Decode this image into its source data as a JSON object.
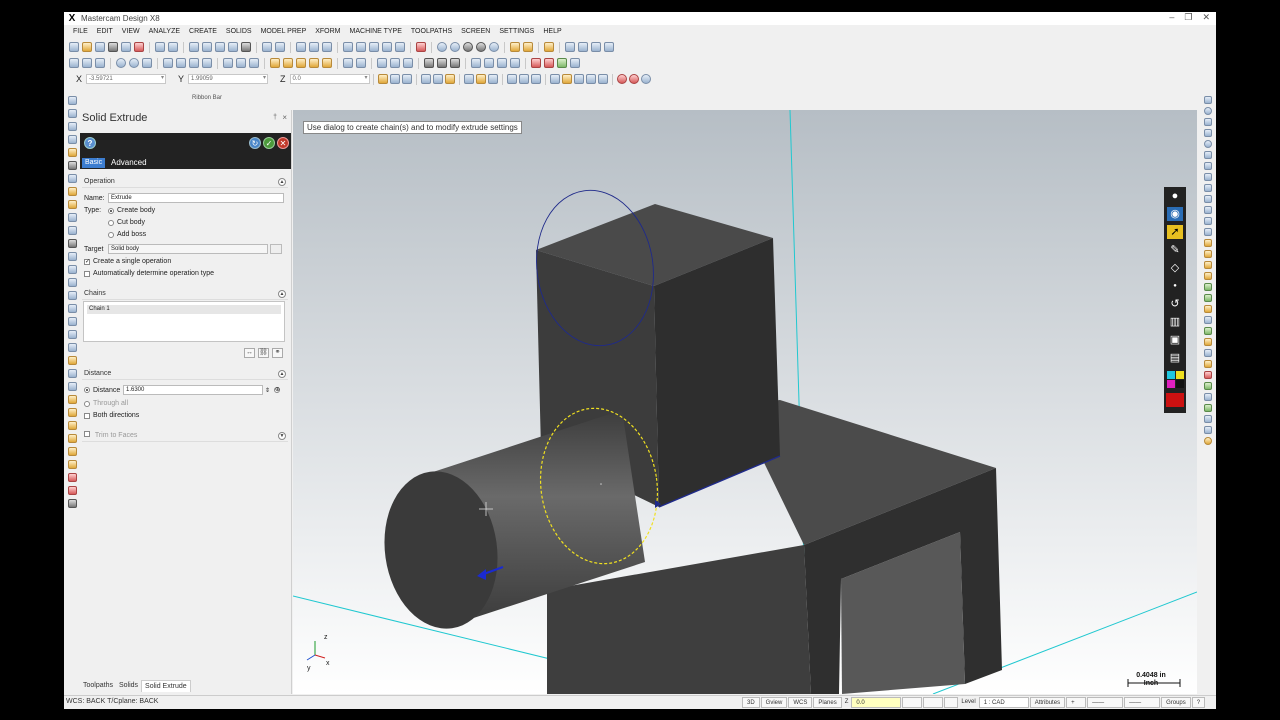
{
  "window": {
    "title": "Mastercam Design X8",
    "icon_glyph": "X"
  },
  "menu": [
    "FILE",
    "EDIT",
    "VIEW",
    "ANALYZE",
    "CREATE",
    "SOLIDS",
    "MODEL PREP",
    "XFORM",
    "MACHINE TYPE",
    "TOOLPATHS",
    "SCREEN",
    "SETTINGS",
    "HELP"
  ],
  "coords": {
    "x_label": "X",
    "x_value": "-3.59721",
    "y_label": "Y",
    "y_value": "1.99059",
    "z_label": "Z",
    "z_value": "0.0"
  },
  "ribbon_bar_label": "Ribbon Bar",
  "panel": {
    "title": "Solid Extrude",
    "pin": "†",
    "close": "×",
    "help": "?",
    "tabs": {
      "basic": "Basic",
      "advanced": "Advanced"
    },
    "operation": {
      "header": "Operation",
      "name_label": "Name:",
      "name_value": "Extrude",
      "type_label": "Type:",
      "types": [
        "Create body",
        "Cut body",
        "Add boss"
      ],
      "target_label": "Target",
      "target_value": "Solid body",
      "single_op": "Create a single operation",
      "auto_type": "Automatically determine operation type"
    },
    "chains": {
      "header": "Chains",
      "items": [
        "Chain  1"
      ]
    },
    "distance": {
      "header": "Distance",
      "distance_label": "Distance",
      "distance_value": "1.6300",
      "through_all": "Through all",
      "both_directions": "Both directions"
    },
    "trim": {
      "label": "Trim to Faces"
    }
  },
  "viewport": {
    "prompt": "Use dialog to create chain(s) and to modify extrude settings",
    "scale_value": "0.4048 in",
    "scale_unit": "Inch",
    "axis_x": "x",
    "axis_y": "y",
    "axis_z": "z"
  },
  "bottom_tabs": [
    "Toolpaths",
    "Solids",
    "Solid Extrude"
  ],
  "status": {
    "left": "WCS: BACK  T/Cplane: BACK",
    "buttons": [
      "3D",
      "Gview",
      "WCS",
      "Planes"
    ],
    "z_label": "Z",
    "z_value": "0.0",
    "level_label": "Level",
    "level_value": "1 : CAD",
    "attributes": "Attributes",
    "groups": "Groups",
    "help": "?"
  },
  "colors": {
    "panel_header": "#222222",
    "tab_active": "#3c7dd0",
    "solid_face_dark": "#3a3a3a",
    "solid_face_mid": "#555555",
    "chain_circle": "#1f2a8a",
    "selected_chain": "#f0e020",
    "axis_cyan": "#20c8d0"
  }
}
